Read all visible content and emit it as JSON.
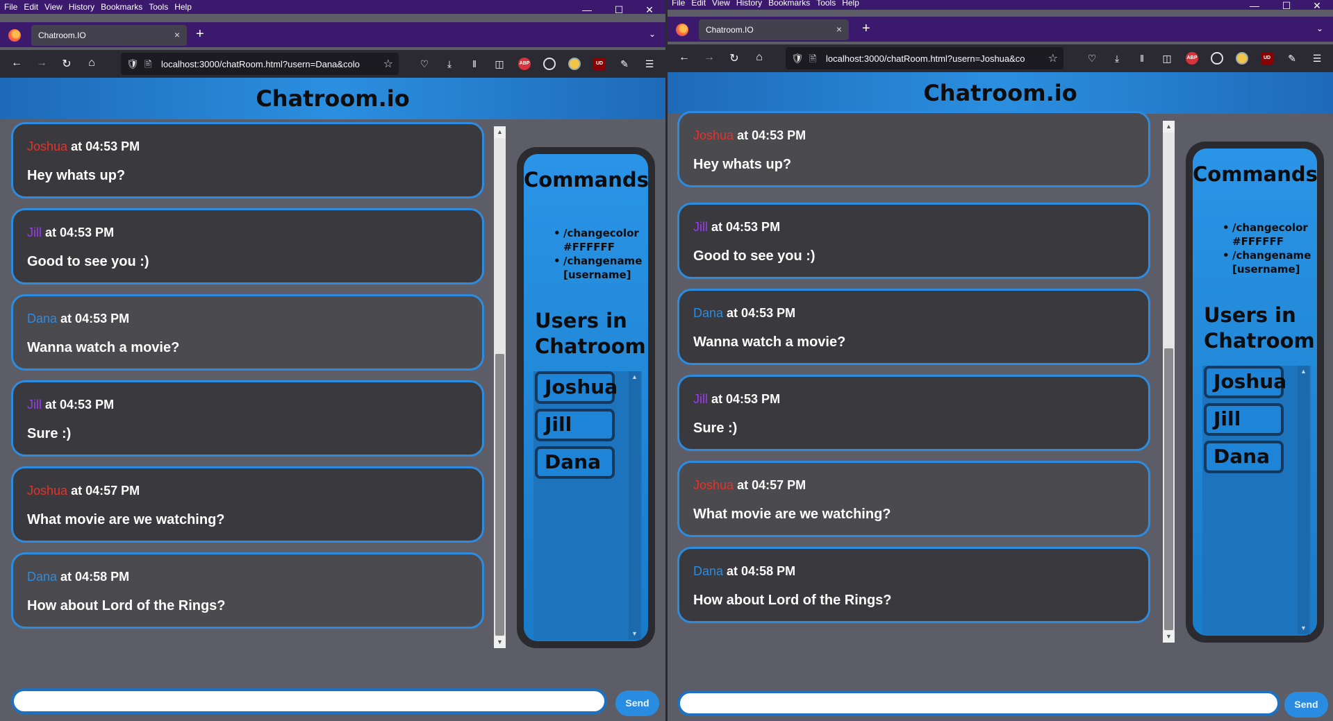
{
  "browser": {
    "menu": [
      "File",
      "Edit",
      "View",
      "History",
      "Bookmarks",
      "Tools",
      "Help"
    ],
    "tab_title": "Chatroom.IO",
    "tab_close": "×",
    "new_tab": "+",
    "window_controls": {
      "minimize": "—",
      "maximize": "☐",
      "close": "✕"
    },
    "nav": {
      "back": "←",
      "forward": "→",
      "reload": "↻",
      "home": "⌂"
    }
  },
  "windows": [
    {
      "url_host": "localhost",
      "url_rest": ":3000/chatRoom.html?usern=Dana&colo",
      "url_host_full": "localhost:3000/chatRoom.html?usern=Dana&colo"
    },
    {
      "url_host_full": "localhost:3000/chatRoom.html?usern=Joshua&co"
    }
  ],
  "app": {
    "title": "Chatroom.io",
    "commands_heading": "Commands",
    "commands": [
      "/changecolor #FFFFFF",
      "/changename [username]"
    ],
    "users_heading_line1": "Users in",
    "users_heading_line2": "Chatroom",
    "users": [
      "Joshua",
      "Jill",
      "Dana"
    ],
    "send_label": "Send",
    "input_value": "",
    "messages": [
      {
        "user": "Joshua",
        "color": "#e8312a",
        "time": "at 04:53 PM",
        "text": "Hey whats up?"
      },
      {
        "user": "Jill",
        "color": "#9b3cf0",
        "time": "at 04:53 PM",
        "text": "Good to see you :)"
      },
      {
        "user": "Dana",
        "color": "#2d8ce0",
        "time": "at 04:53 PM",
        "text": "Wanna watch a movie?"
      },
      {
        "user": "Jill",
        "color": "#9b3cf0",
        "time": "at 04:53 PM",
        "text": "Sure :)"
      },
      {
        "user": "Joshua",
        "color": "#e8312a",
        "time": "at 04:57 PM",
        "text": "What movie are we watching?"
      },
      {
        "user": "Dana",
        "color": "#2d8ce0",
        "time": "at 04:58 PM",
        "text": "How about Lord of the Rings?"
      }
    ]
  },
  "colors": {
    "accent": "#2d8ce0",
    "header": "#2b8fe0",
    "page_bg": "#5c5d66",
    "titlebar": "#3b1a6e"
  }
}
